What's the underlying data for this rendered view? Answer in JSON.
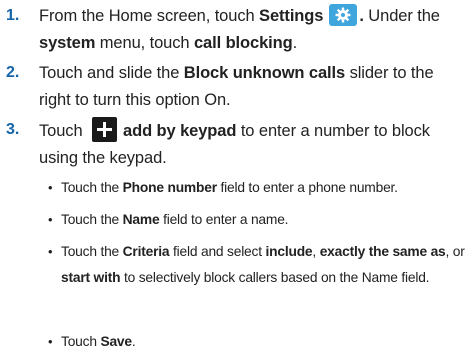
{
  "steps": [
    {
      "number": "1.",
      "t1": "From the Home screen, touch ",
      "b1": "Settings",
      "t2": ".",
      "t3": " Under the ",
      "b2": "system",
      "t4": " menu, touch ",
      "b3": "call blocking",
      "t5": ".",
      "icon": "settings-gear-icon"
    },
    {
      "number": "2.",
      "t1": "Touch and slide the ",
      "b1": "Block unknown calls",
      "t2": " slider to the right to turn this option On."
    },
    {
      "number": "3.",
      "t1": "Touch ",
      "b1": "add by keypad",
      "t2": " to enter a number to block using the keypad.",
      "icon": "add-plus-icon",
      "bullets": [
        {
          "t1": "Touch the ",
          "b1": "Phone number",
          "t2": " field to enter a phone number."
        },
        {
          "t1": "Touch the ",
          "b1": "Name",
          "t2": " field to enter a name."
        },
        {
          "t1": "Touch the ",
          "b1": "Criteria",
          "t2": " field and select ",
          "b2": "include",
          "t3": ", ",
          "b3": "exactly the same as",
          "t4": ", or ",
          "b4": "start with",
          "t5": " to selectively block callers based on the Name field."
        },
        {
          "t1": "Touch ",
          "b1": "Save",
          "t2": "."
        }
      ]
    }
  ],
  "bullet_glyph": "•",
  "colors": {
    "step_number": "#1565a8",
    "settings_icon_bg": "#3ea6dc",
    "add_icon_bg": "#1a1a1a",
    "text": "#222222"
  }
}
